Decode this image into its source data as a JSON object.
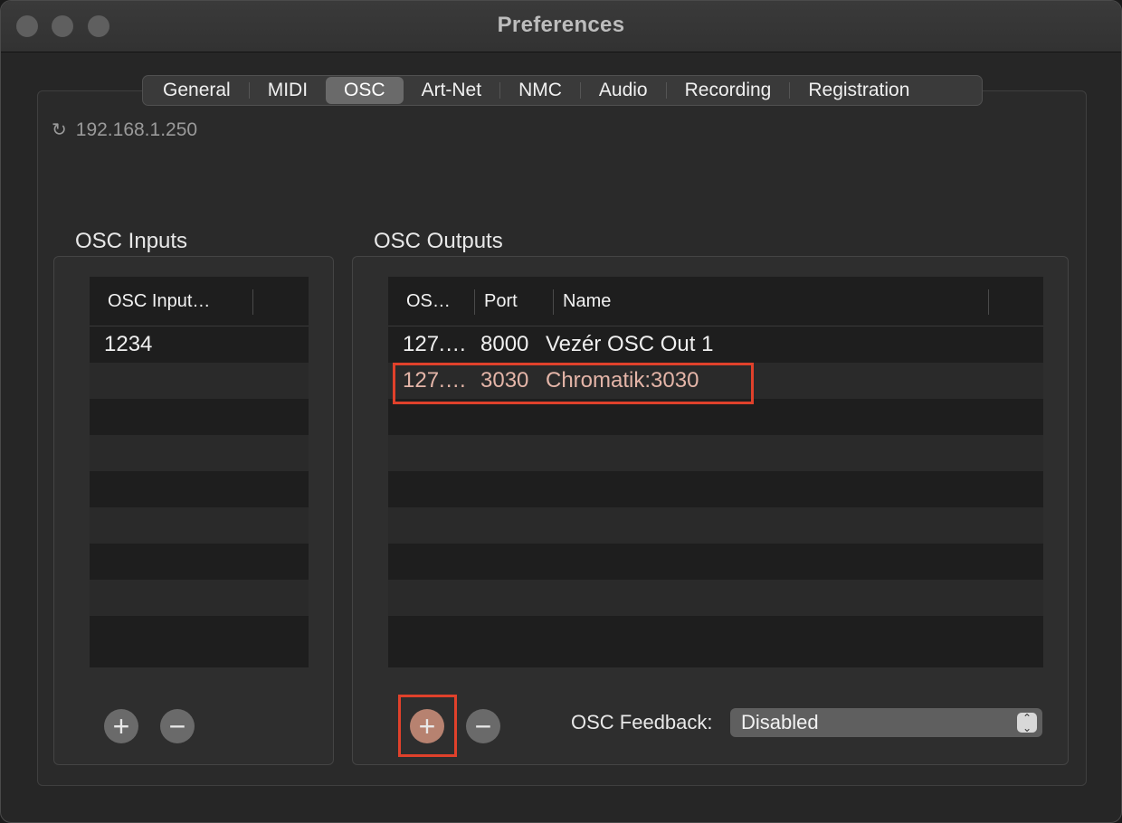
{
  "window": {
    "title": "Preferences"
  },
  "tabs": [
    {
      "label": "General",
      "active": false
    },
    {
      "label": "MIDI",
      "active": false
    },
    {
      "label": "OSC",
      "active": true
    },
    {
      "label": "Art-Net",
      "active": false
    },
    {
      "label": "NMC",
      "active": false
    },
    {
      "label": "Audio",
      "active": false
    },
    {
      "label": "Recording",
      "active": false
    },
    {
      "label": "Registration",
      "active": false
    }
  ],
  "ip": {
    "icon": "refresh-icon",
    "address": "192.168.1.250"
  },
  "osc_inputs": {
    "title": "OSC Inputs",
    "columns": [
      "OSC Input…"
    ],
    "rows": [
      [
        "1234"
      ]
    ]
  },
  "osc_outputs": {
    "title": "OSC Outputs",
    "columns": [
      "OS…",
      "Port",
      "Name"
    ],
    "rows": [
      [
        "127.…",
        "8000",
        "Vezér OSC Out 1"
      ],
      [
        "127.…",
        "3030",
        "Chromatik:3030"
      ]
    ]
  },
  "buttons": {
    "add": "+",
    "remove": "−"
  },
  "feedback": {
    "label": "OSC Feedback:",
    "value": "Disabled"
  },
  "colors": {
    "highlight": "#e0412b",
    "active_tab": "#6a6a6a"
  }
}
